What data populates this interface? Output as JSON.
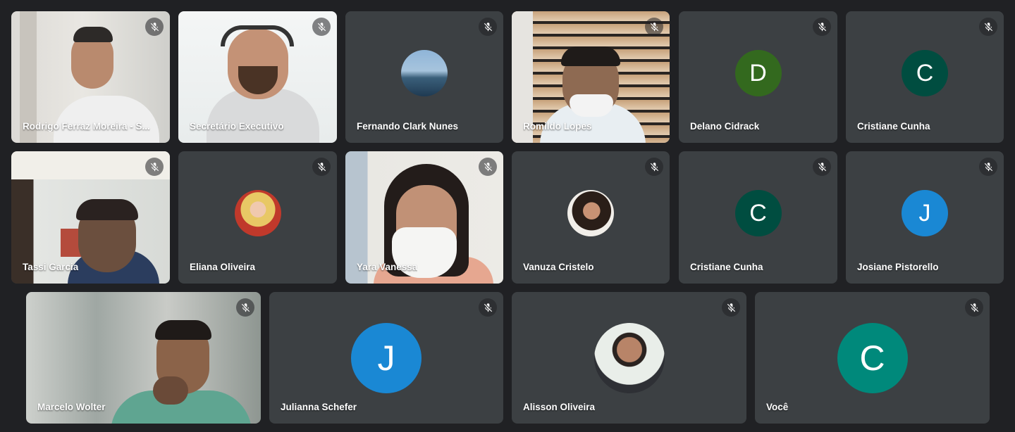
{
  "colors": {
    "background": "#202124",
    "tile": "#3c4043",
    "avatar_green": "#33691e",
    "avatar_dark_teal": "#004d40",
    "avatar_blue": "#1a88d4",
    "avatar_teal": "#00897b"
  },
  "participants": [
    {
      "name": "Rodrigo Ferraz Moreira - S...",
      "mic": "muted",
      "type": "video"
    },
    {
      "name": "Secretário Executivo",
      "mic": "muted",
      "type": "video"
    },
    {
      "name": "Fernando Clark Nunes",
      "mic": "muted",
      "type": "photo-avatar",
      "icon": "city-photo"
    },
    {
      "name": "Romildo Lopes",
      "mic": "muted",
      "type": "video"
    },
    {
      "name": "Delano Cidrack",
      "mic": "muted",
      "type": "letter-avatar",
      "letter": "D",
      "color": "#33691e"
    },
    {
      "name": "Cristiane Cunha",
      "mic": "muted",
      "type": "letter-avatar",
      "letter": "C",
      "color": "#004d40"
    },
    {
      "name": "Tassi Garcia",
      "mic": "muted",
      "type": "video"
    },
    {
      "name": "Eliana Oliveira",
      "mic": "muted",
      "type": "photo-avatar",
      "icon": "person-photo"
    },
    {
      "name": "Yara Vanessa",
      "mic": "muted",
      "type": "video"
    },
    {
      "name": "Vanuza Cristelo",
      "mic": "muted",
      "type": "photo-avatar",
      "icon": "person-photo"
    },
    {
      "name": "Cristiane Cunha",
      "mic": "muted",
      "type": "letter-avatar",
      "letter": "C",
      "color": "#004d40"
    },
    {
      "name": "Josiane Pistorello",
      "mic": "muted",
      "type": "letter-avatar",
      "letter": "J",
      "color": "#1a88d4"
    },
    {
      "name": "Marcelo Wolter",
      "mic": "muted",
      "type": "video"
    },
    {
      "name": "Julianna Schefer",
      "mic": "muted",
      "type": "letter-avatar",
      "letter": "J",
      "color": "#1a88d4"
    },
    {
      "name": "Alisson Oliveira",
      "mic": "muted",
      "type": "photo-avatar",
      "icon": "person-photo"
    },
    {
      "name": "Você",
      "mic": "muted",
      "type": "letter-avatar",
      "letter": "C",
      "color": "#00897b"
    }
  ]
}
